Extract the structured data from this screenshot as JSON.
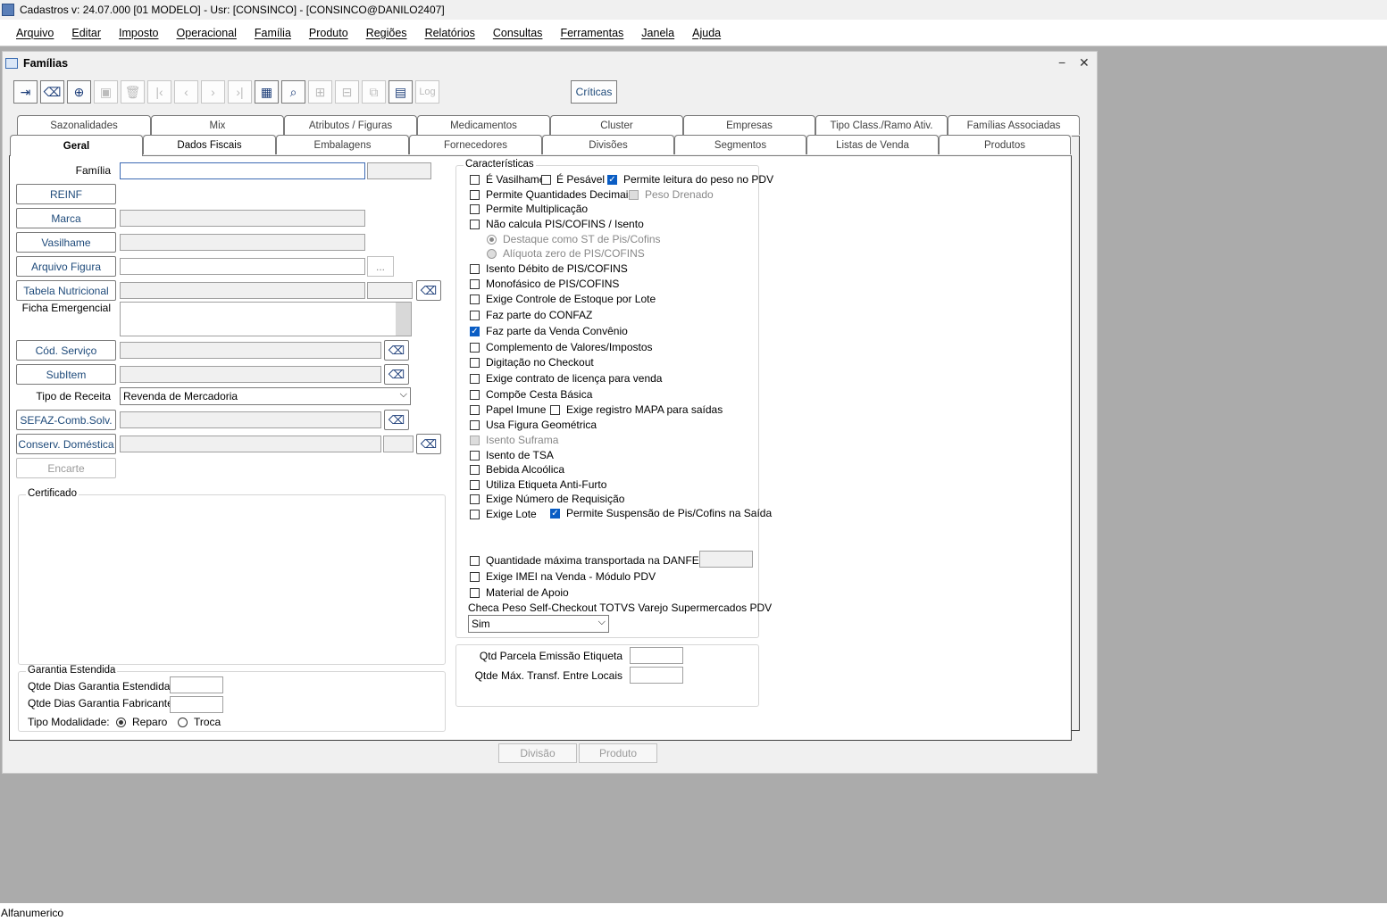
{
  "app": {
    "title": "Cadastros  v: 24.07.000   [01 MODELO] - Usr: [CONSINCO] - [CONSINCO@DANILO2407]"
  },
  "menu": [
    "Arquivo",
    "Editar",
    "Imposto",
    "Operacional",
    "Família",
    "Produto",
    "Regiões",
    "Relatórios",
    "Consultas",
    "Ferramentas",
    "Janela",
    "Ajuda"
  ],
  "window": {
    "title": "Famílias",
    "minimize": "−",
    "close": "✕"
  },
  "toolbar": {
    "criticas": "Críticas",
    "log": "Log"
  },
  "tabs_row1": [
    "Sazonalidades",
    "Mix",
    "Atributos / Figuras",
    "Medicamentos",
    "Cluster",
    "Empresas",
    "Tipo Class./Ramo Ativ.",
    "Famílias Associadas"
  ],
  "tabs_row2": [
    "Geral",
    "Dados Fiscais",
    "Embalagens",
    "Fornecedores",
    "Divisões",
    "Segmentos",
    "Listas de Venda",
    "Produtos"
  ],
  "left": {
    "familia_label": "Família",
    "reinf": "REINF",
    "marca": "Marca",
    "vasilhame": "Vasilhame",
    "arquivo_figura": "Arquivo Figura",
    "dots": "...",
    "tabela_nutricional": "Tabela Nutricional",
    "ficha_emergencial": "Ficha Emergencial",
    "cod_servico": "Cód. Serviço",
    "subitem": "SubItem",
    "tipo_receita_label": "Tipo de Receita",
    "tipo_receita_value": "Revenda de Mercadoria",
    "sefaz": "SEFAZ-Comb.Solv.",
    "conserv": "Conserv. Doméstica",
    "encarte": "Encarte",
    "certificado": "Certificado",
    "garantia": "Garantia Estendida",
    "qtde_dias_estendida": "Qtde Dias Garantia Estendida",
    "qtde_dias_fabricante": "Qtde Dias Garantia Fabricante",
    "tipo_modalidade": "Tipo Modalidade:",
    "reparo": "Reparo",
    "troca": "Troca"
  },
  "caracteristicas": {
    "title": "Características",
    "vasilhame": "É Vasilhame",
    "pesavel": "É Pesável",
    "permite_leitura": "Permite leitura do peso no PDV",
    "qtd_decimais": "Permite Quantidades Decimais",
    "peso_drenado": "Peso Drenado",
    "multiplicacao": "Permite Multiplicação",
    "nao_calcula": "Não calcula PIS/COFINS / Isento",
    "destaque": "Destaque como ST de Pis/Cofins",
    "aliquota_zero": "Alíquota zero de PIS/COFINS",
    "isento_debito": "Isento Débito de PIS/COFINS",
    "monofasico": "Monofásico de PIS/COFINS",
    "controle_lote": "Exige Controle de Estoque por Lote",
    "confaz": "Faz parte do CONFAZ",
    "venda_convenio": "Faz parte da Venda Convênio",
    "complemento": "Complemento de Valores/Impostos",
    "digitacao": "Digitação no Checkout",
    "contrato": "Exige contrato de licença para venda",
    "cesta": "Compõe Cesta Básica",
    "papel_imune": "Papel Imune",
    "mapa": "Exige registro MAPA para saídas",
    "figura_geom": "Usa Figura Geométrica",
    "suframa": "Isento Suframa",
    "tsa": "Isento de TSA",
    "bebida": "Bebida Alcoólica",
    "etiqueta": "Utiliza Etiqueta Anti-Furto",
    "requisicao": "Exige Número de Requisição",
    "exige_lote": "Exige Lote",
    "suspensao": "Permite Suspensão de Pis/Cofins na Saída",
    "qtd_max_danfe": "Quantidade máxima transportada na DANFE (KG)",
    "imei": "Exige IMEI na Venda - Módulo PDV",
    "material_apoio": "Material de Apoio",
    "checa_peso": "Checa Peso Self-Checkout TOTVS Varejo Supermercados PDV",
    "checa_peso_value": "Sim"
  },
  "etiqueta_box": {
    "qtd_parcela": "Qtd Parcela Emissão Etiqueta",
    "qtde_max": "Qtde Máx. Transf. Entre Locais"
  },
  "bottom": {
    "divisao": "Divisão",
    "produto": "Produto"
  },
  "status": "Alfanumerico"
}
